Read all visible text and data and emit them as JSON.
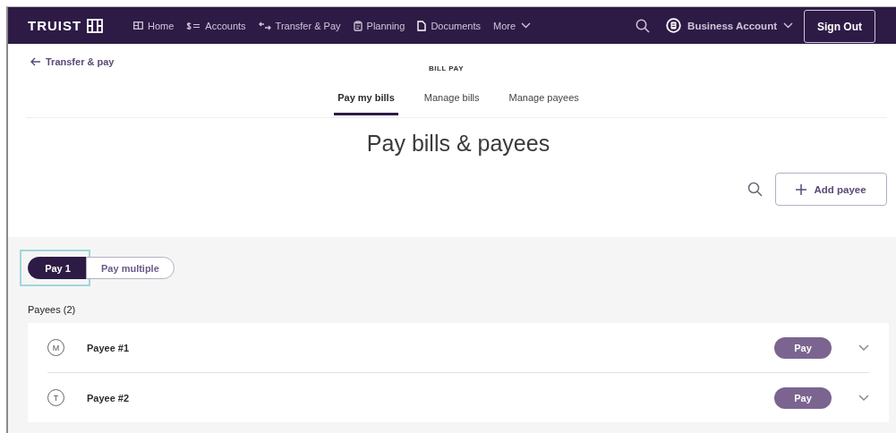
{
  "nav": {
    "brand": "TRUIST",
    "items": [
      {
        "label": "Home",
        "kind": "home"
      },
      {
        "label": "Accounts",
        "kind": "accounts"
      },
      {
        "label": "Transfer & Pay",
        "kind": "transfer"
      },
      {
        "label": "Planning",
        "kind": "planning"
      },
      {
        "label": "Documents",
        "kind": "documents"
      },
      {
        "label": "More",
        "kind": "more"
      }
    ],
    "account": "Business Account",
    "sign_out": "Sign Out"
  },
  "back_link": "Transfer & pay",
  "section": "BILL PAY",
  "tabs": [
    {
      "label": "Pay my bills",
      "selected": true
    },
    {
      "label": "Manage bills",
      "selected": false
    },
    {
      "label": "Manage payees",
      "selected": false
    }
  ],
  "title": "Pay bills & payees",
  "add_button": "Add payee",
  "mode": [
    {
      "label": "Pay 1",
      "selected": true,
      "focused": true
    },
    {
      "label": "Pay multiple",
      "selected": false,
      "focused": false
    }
  ],
  "payees_heading": "Payees (2)",
  "payees": [
    {
      "initial": "M",
      "name": "Payee #1",
      "action": "Pay",
      "expanded": false
    },
    {
      "initial": "T",
      "name": "Payee #2",
      "action": "Pay",
      "expanded": false
    }
  ]
}
